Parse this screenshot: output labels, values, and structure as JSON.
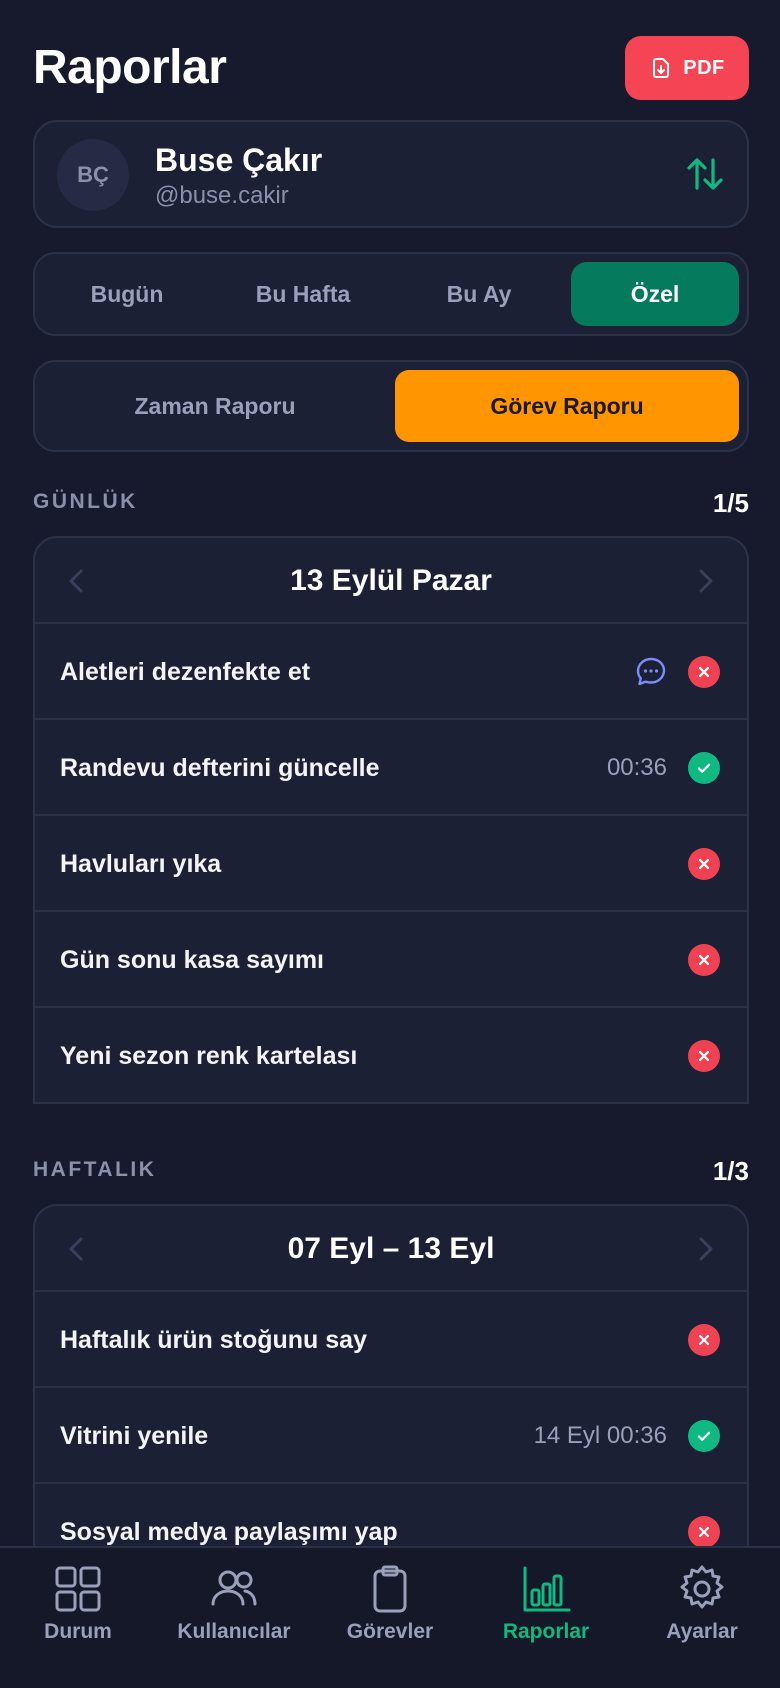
{
  "header": {
    "title": "Raporlar",
    "pdf_label": "PDF"
  },
  "user": {
    "initials": "BÇ",
    "name": "Buse Çakır",
    "handle": "@buse.cakir"
  },
  "period_tabs": [
    {
      "label": "Bugün",
      "active": false
    },
    {
      "label": "Bu Hafta",
      "active": false
    },
    {
      "label": "Bu Ay",
      "active": false
    },
    {
      "label": "Özel",
      "active": true
    }
  ],
  "report_tabs": [
    {
      "label": "Zaman Raporu",
      "active": false
    },
    {
      "label": "Görev Raporu",
      "active": true
    }
  ],
  "daily": {
    "label": "GÜNLÜK",
    "count": "1/5",
    "date": "13 Eylül Pazar",
    "tasks": [
      {
        "name": "Aletleri dezenfekte et",
        "time": "",
        "status": "fail",
        "has_comment": true
      },
      {
        "name": "Randevu defterini güncelle",
        "time": "00:36",
        "status": "done",
        "has_comment": false
      },
      {
        "name": "Havluları yıka",
        "time": "",
        "status": "fail",
        "has_comment": false
      },
      {
        "name": "Gün sonu kasa sayımı",
        "time": "",
        "status": "fail",
        "has_comment": false
      },
      {
        "name": "Yeni sezon renk kartelası",
        "time": "",
        "status": "fail",
        "has_comment": false
      }
    ]
  },
  "weekly": {
    "label": "HAFTALIK",
    "count": "1/3",
    "date": "07 Eyl – 13 Eyl",
    "tasks": [
      {
        "name": "Haftalık ürün stoğunu say",
        "time": "",
        "status": "fail"
      },
      {
        "name": "Vitrini yenile",
        "time": "14 Eyl 00:36",
        "status": "done"
      },
      {
        "name": "Sosyal medya paylaşımı yap",
        "time": "",
        "status": "fail"
      }
    ]
  },
  "tabbar": [
    {
      "label": "Durum",
      "icon": "grid-icon",
      "active": false
    },
    {
      "label": "Kullanıcılar",
      "icon": "users-icon",
      "active": false
    },
    {
      "label": "Görevler",
      "icon": "clipboard-icon",
      "active": false
    },
    {
      "label": "Raporlar",
      "icon": "bar-chart-icon",
      "active": true
    },
    {
      "label": "Ayarlar",
      "icon": "gear-icon",
      "active": false
    }
  ],
  "colors": {
    "background": "#161a2c",
    "accent_green": "#10b981",
    "active_period": "#067a5c",
    "active_report": "#ff9500",
    "pdf": "#f54555",
    "fail": "#ef4353"
  }
}
